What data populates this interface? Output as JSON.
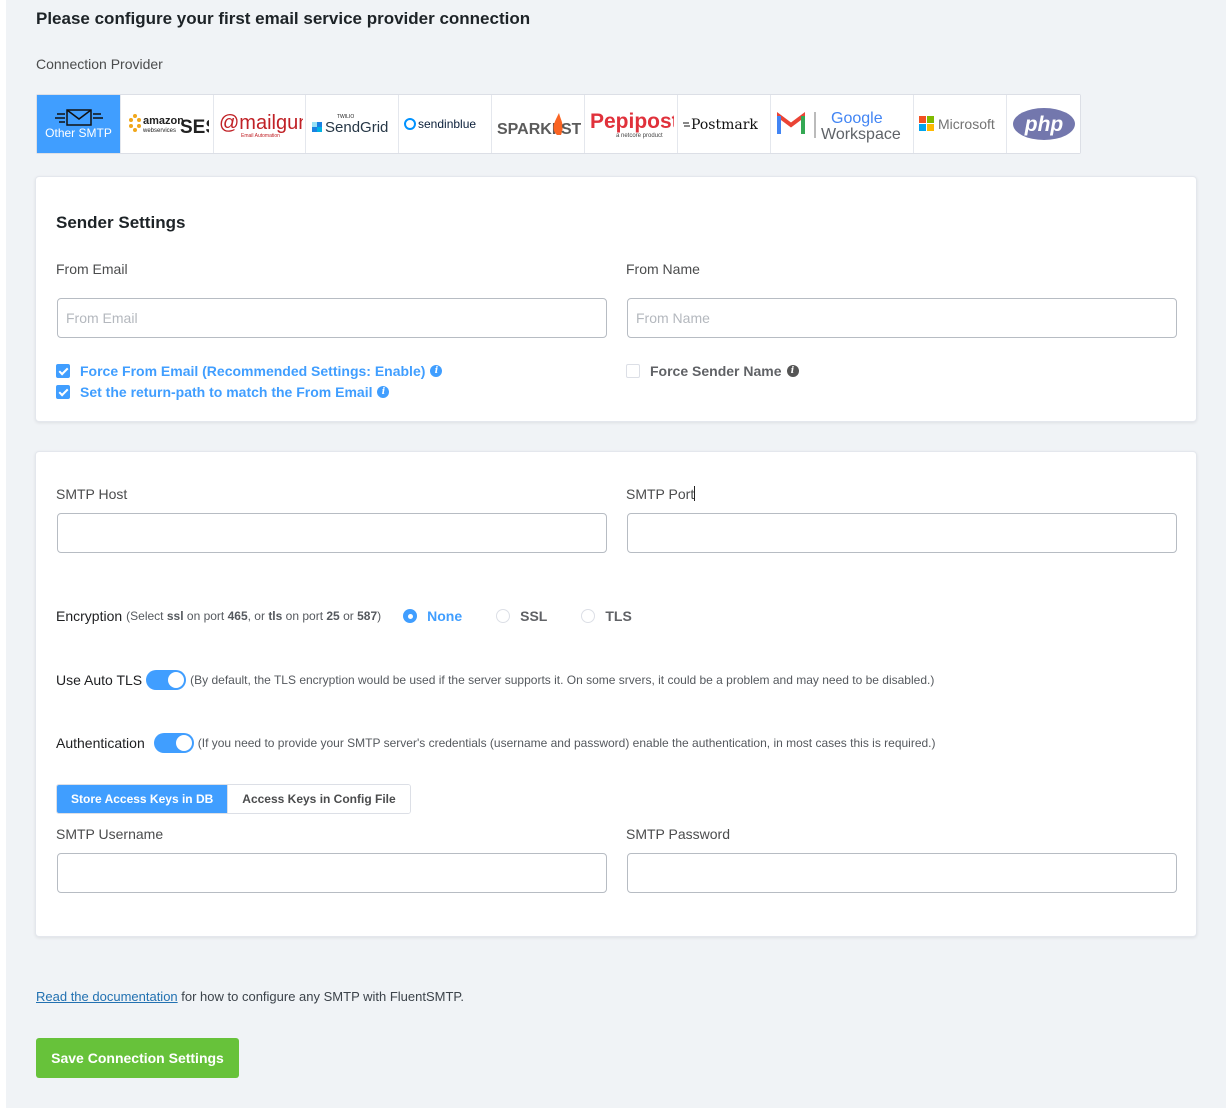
{
  "heading": "Please configure your first email service provider connection",
  "provider_label": "Connection Provider",
  "providers": [
    {
      "name": "Other SMTP",
      "active": true
    },
    {
      "name": "amazon webservices SES"
    },
    {
      "name": "mailgun"
    },
    {
      "name": "SendGrid",
      "sub": "TWILIO"
    },
    {
      "name": "sendinblue"
    },
    {
      "name": "SPARKPOST"
    },
    {
      "name": "Pepipost",
      "sub": "a netcore product"
    },
    {
      "name": "Postmark"
    },
    {
      "name": "Google Workspace"
    },
    {
      "name": "Microsoft"
    },
    {
      "name": "php"
    }
  ],
  "sender": {
    "title": "Sender Settings",
    "from_email_label": "From Email",
    "from_email_placeholder": "From Email",
    "from_name_label": "From Name",
    "from_name_placeholder": "From Name",
    "force_from_email": "Force From Email (Recommended Settings: Enable)",
    "return_path": "Set the return-path to match the From Email",
    "force_sender_name": "Force Sender Name"
  },
  "smtp": {
    "host_label": "SMTP Host",
    "port_label": "SMTP Port",
    "encryption_label": "Encryption",
    "encryption_hint_1": "(Select",
    "encryption_hint_ssl": "ssl",
    "encryption_hint_2": "on port",
    "encryption_hint_465": "465",
    "encryption_hint_3": ", or",
    "encryption_hint_tls": "tls",
    "encryption_hint_4": "on port",
    "encryption_hint_25": "25",
    "encryption_hint_5": "or",
    "encryption_hint_587": "587",
    "encryption_hint_6": ")",
    "options": [
      "None",
      "SSL",
      "TLS"
    ],
    "selected_option": "None",
    "auto_tls_label": "Use Auto TLS",
    "auto_tls_hint": "(By default, the TLS encryption would be used if the server supports it. On some srvers, it could be a problem and may need to be disabled.)",
    "auth_label": "Authentication",
    "auth_hint": "(If you need to provide your SMTP server's credentials (username and password) enable the authentication, in most cases this is required.)",
    "store_db": "Store Access Keys in DB",
    "store_config": "Access Keys in Config File",
    "username_label": "SMTP Username",
    "password_label": "SMTP Password"
  },
  "footer": {
    "doc_link": "Read the documentation",
    "doc_rest": " for how to configure any SMTP with FluentSMTP.",
    "save_button": "Save Connection Settings"
  },
  "colors": {
    "accent": "#409eff",
    "save": "#67c23a",
    "info_icon_blue": "#409eff",
    "info_icon_dark": "#555555"
  }
}
